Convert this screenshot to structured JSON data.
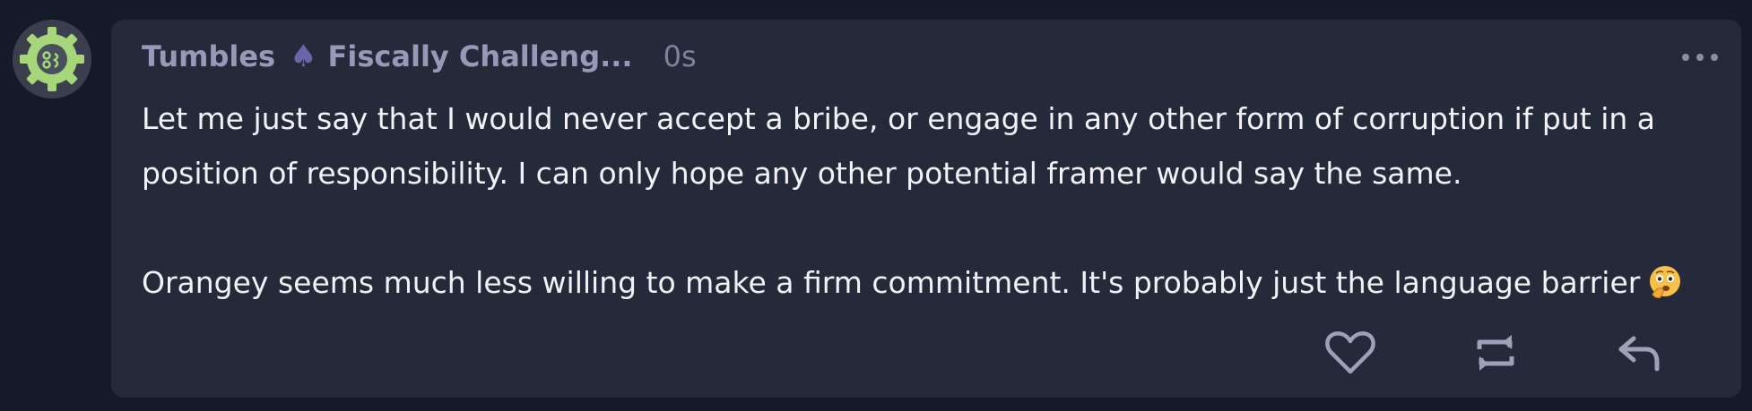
{
  "post": {
    "author": "Tumbles",
    "author_icon": "spade-icon",
    "display_tag": "Fiscally Challeng...",
    "timestamp": "0s",
    "paragraph_1": "Let me just say that I would never accept a bribe, or engage in any other form of corruption if put in a position of responsibility. I can only hope any other potential framer would say the same.",
    "paragraph_2": "Orangey seems much less willing to make a firm commitment. It's probably just the language barrier",
    "emoji": "thinking-face-emoji"
  },
  "actions": {
    "like": "heart-icon",
    "boost": "repost-icon",
    "reply": "reply-icon",
    "menu": "more-options-icon"
  },
  "colors": {
    "page_bg": "#151a28",
    "card_bg": "#252a3a",
    "name": "#9a98b8",
    "spade": "#6a65a8",
    "body_text": "#f2f2f6",
    "icon": "#9ea1b8",
    "avatar_gear": "#a5d67a"
  }
}
